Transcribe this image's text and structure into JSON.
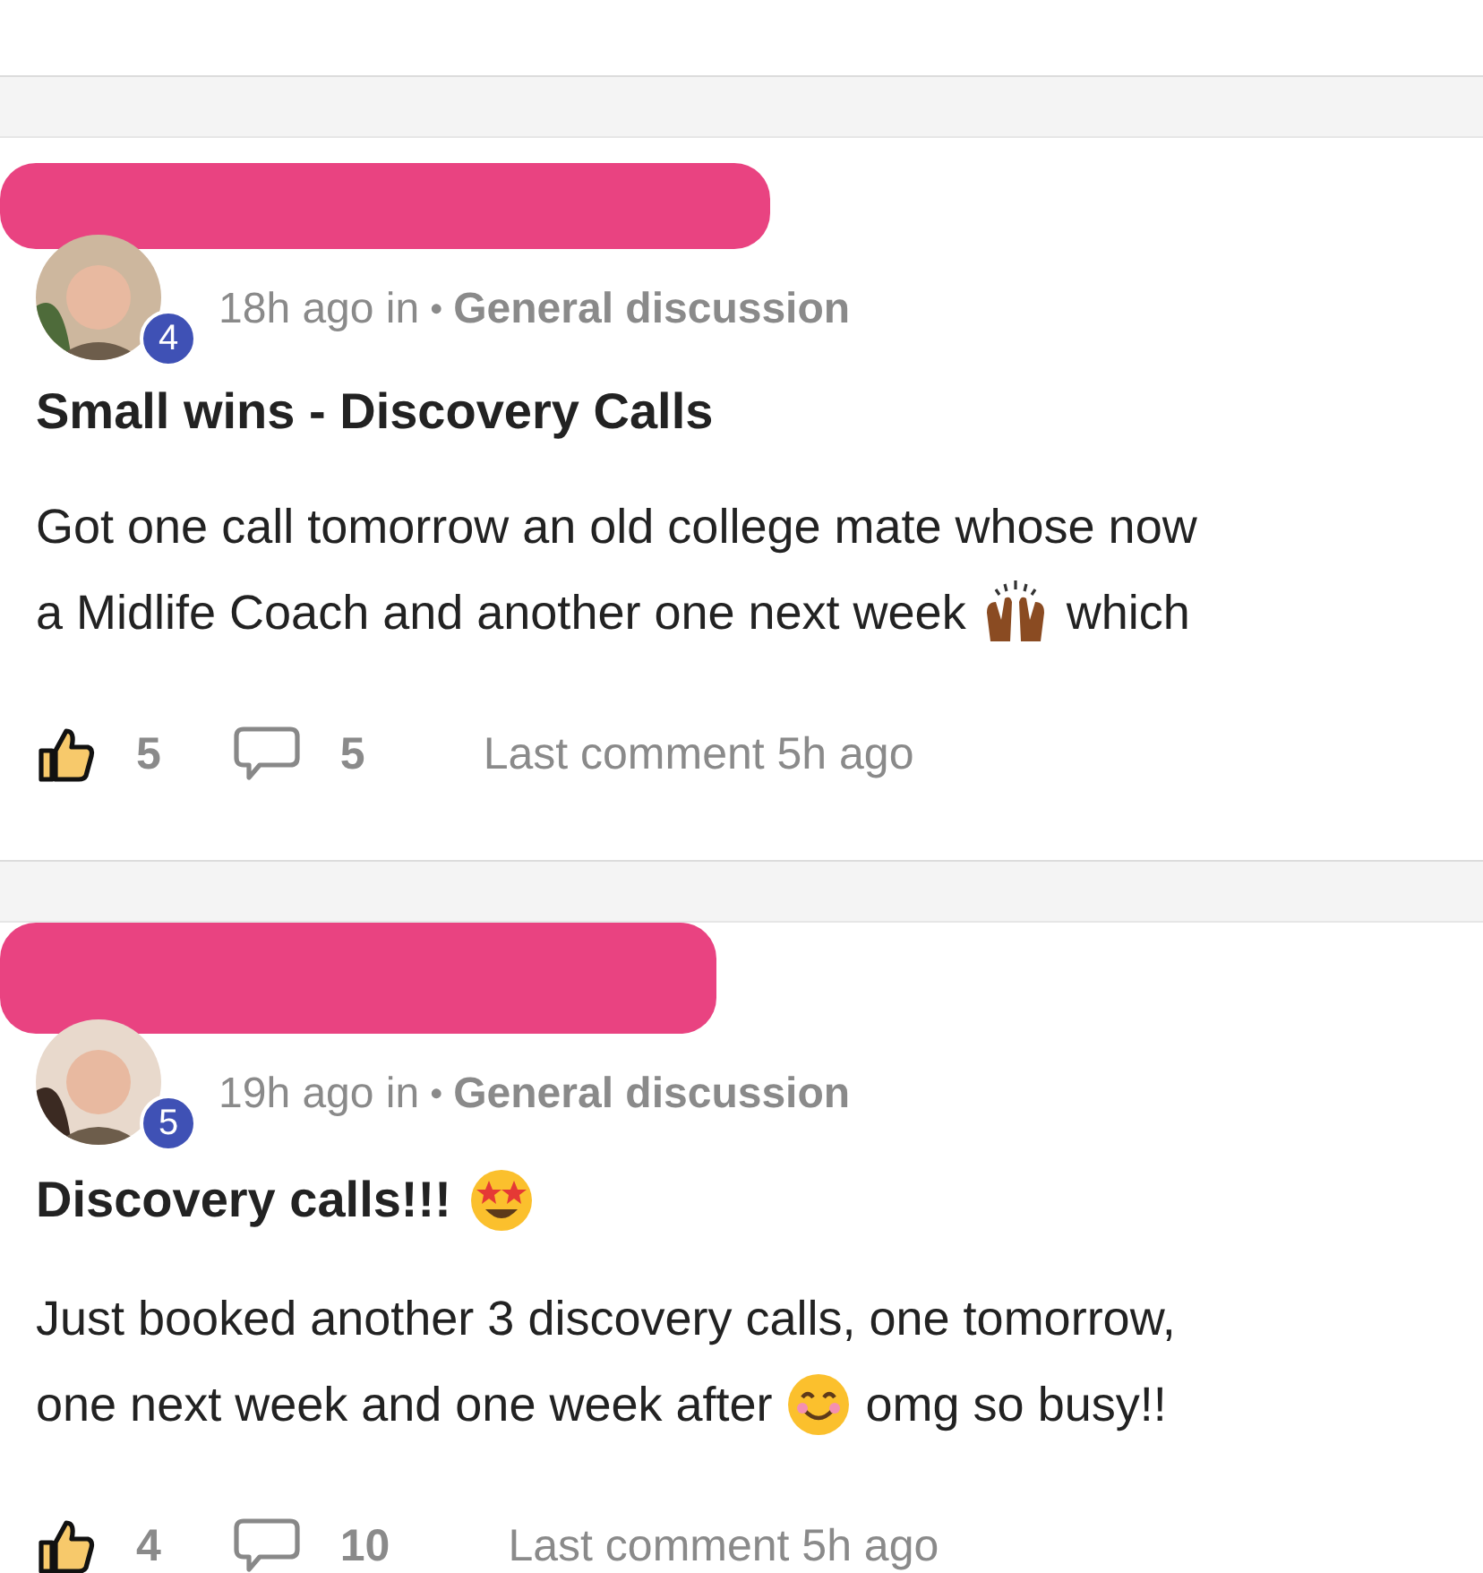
{
  "posts": [
    {
      "badge": "4",
      "time": "18h ago in",
      "separator": "•",
      "category": "General discussion",
      "title": [
        {
          "kind": "text",
          "text": "Small wins - Discovery Calls"
        }
      ],
      "body": [
        [
          {
            "kind": "text",
            "text": "Got one call tomorrow an old college mate whose now"
          }
        ],
        [
          {
            "kind": "text",
            "text": "a Midlife Coach and another one next week"
          },
          {
            "kind": "raised-hands"
          },
          {
            "kind": "text",
            "text": "which"
          }
        ]
      ],
      "likes": "5",
      "comments": "5",
      "last_comment": "Last comment 5h ago"
    },
    {
      "badge": "5",
      "time": "19h ago in",
      "separator": "•",
      "category": "General discussion",
      "title": [
        {
          "kind": "text",
          "text": "Discovery calls!!!"
        },
        {
          "kind": "star-eyes"
        }
      ],
      "body": [
        [
          {
            "kind": "text",
            "text": "Just booked another 3 discovery calls, one tomorrow,"
          }
        ],
        [
          {
            "kind": "text",
            "text": "one next week and one week after"
          },
          {
            "kind": "smile"
          },
          {
            "kind": "text",
            "text": "omg so busy!!"
          }
        ]
      ],
      "likes": "4",
      "comments": "10",
      "last_comment": "Last comment 5h ago"
    }
  ]
}
